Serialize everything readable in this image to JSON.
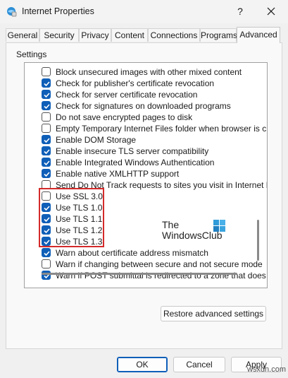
{
  "window": {
    "title": "Internet Properties",
    "help_label": "?"
  },
  "tabs": [
    {
      "label": "General"
    },
    {
      "label": "Security"
    },
    {
      "label": "Privacy"
    },
    {
      "label": "Content"
    },
    {
      "label": "Connections"
    },
    {
      "label": "Programs"
    },
    {
      "label": "Advanced",
      "active": true
    }
  ],
  "settings": {
    "group_label": "Settings",
    "items": [
      {
        "label": "Block unsecured images with other mixed content",
        "checked": false
      },
      {
        "label": "Check for publisher's certificate revocation",
        "checked": true
      },
      {
        "label": "Check for server certificate revocation",
        "checked": true
      },
      {
        "label": "Check for signatures on downloaded programs",
        "checked": true
      },
      {
        "label": "Do not save encrypted pages to disk",
        "checked": false
      },
      {
        "label": "Empty Temporary Internet Files folder when browser is clo",
        "checked": false
      },
      {
        "label": "Enable DOM Storage",
        "checked": true
      },
      {
        "label": "Enable insecure TLS server compatibility",
        "checked": true
      },
      {
        "label": "Enable Integrated Windows Authentication",
        "checked": true
      },
      {
        "label": "Enable native XMLHTTP support",
        "checked": true
      },
      {
        "label": "Send Do Not Track requests to sites you visit in Internet E",
        "checked": false
      },
      {
        "label": "Use SSL 3.0",
        "checked": false
      },
      {
        "label": "Use TLS 1.0",
        "checked": true
      },
      {
        "label": "Use TLS 1.1",
        "checked": true
      },
      {
        "label": "Use TLS 1.2",
        "checked": true
      },
      {
        "label": "Use TLS 1.3",
        "checked": true
      },
      {
        "label": "Warn about certificate address mismatch",
        "checked": true
      },
      {
        "label": "Warn if changing between secure and not secure mode",
        "checked": false
      },
      {
        "label": "Warn if POST submittal is redirected to a zone that does n",
        "checked": true
      }
    ],
    "restore_label": "Restore advanced settings"
  },
  "watermark": {
    "line1": "The",
    "line2": "WindowsClub"
  },
  "footer": {
    "ok_label": "OK",
    "cancel_label": "Cancel",
    "apply_label": "Apply"
  },
  "site_tag": "wsxdn.com",
  "colors": {
    "accent": "#0f5fb8",
    "highlight": "#d42a2a"
  }
}
